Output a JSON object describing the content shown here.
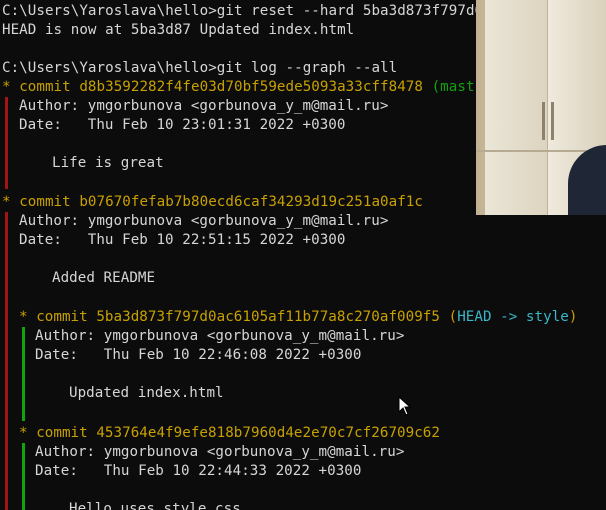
{
  "terminal": {
    "prompt1": "C:\\Users\\Yaroslava\\hello>git reset --hard 5ba3d873f797d0",
    "output1": "HEAD is now at 5ba3d87 Updated index.html",
    "prompt2": "C:\\Users\\Yaroslava\\hello>git log --graph --all",
    "commits": [
      {
        "hash": "commit d8b3592282f4fe03d70bf59ede5093a33cff8478",
        "ref": "(mast",
        "author": "Author: ymgorbunova <gorbunova_y_m@mail.ru>",
        "date": "Date:   Thu Feb 10 23:01:31 2022 +0300",
        "message": "Life is great"
      },
      {
        "hash": "commit b07670fefab7b80ecd6caf34293d19c251a0af1c",
        "author": "Author: ymgorbunova <gorbunova_y_m@mail.ru>",
        "date": "Date:   Thu Feb 10 22:51:15 2022 +0300",
        "message": "Added README"
      },
      {
        "hash": "commit 5ba3d873f797d0ac6105af11b77a8c270af009f5",
        "ref_head": "HEAD -> style",
        "author": "Author: ymgorbunova <gorbunova_y_m@mail.ru>",
        "date": "Date:   Thu Feb 10 22:46:08 2022 +0300",
        "message": "Updated index.html"
      },
      {
        "hash": "commit 453764e4f9efe818b7960d4e2e70c7cf26709c62",
        "author": "Author: ymgorbunova <gorbunova_y_m@mail.ru>",
        "date": "Date:   Thu Feb 10 22:44:33 2022 +0300",
        "message": "Hello uses style.css"
      }
    ]
  },
  "colors": {
    "background": "#0c0c0c",
    "text": "#d6d6d6",
    "hash": "#c8a100",
    "branch_green": "#13a10e",
    "head_cyan": "#3ab7c8",
    "graph_red": "#a31515"
  }
}
